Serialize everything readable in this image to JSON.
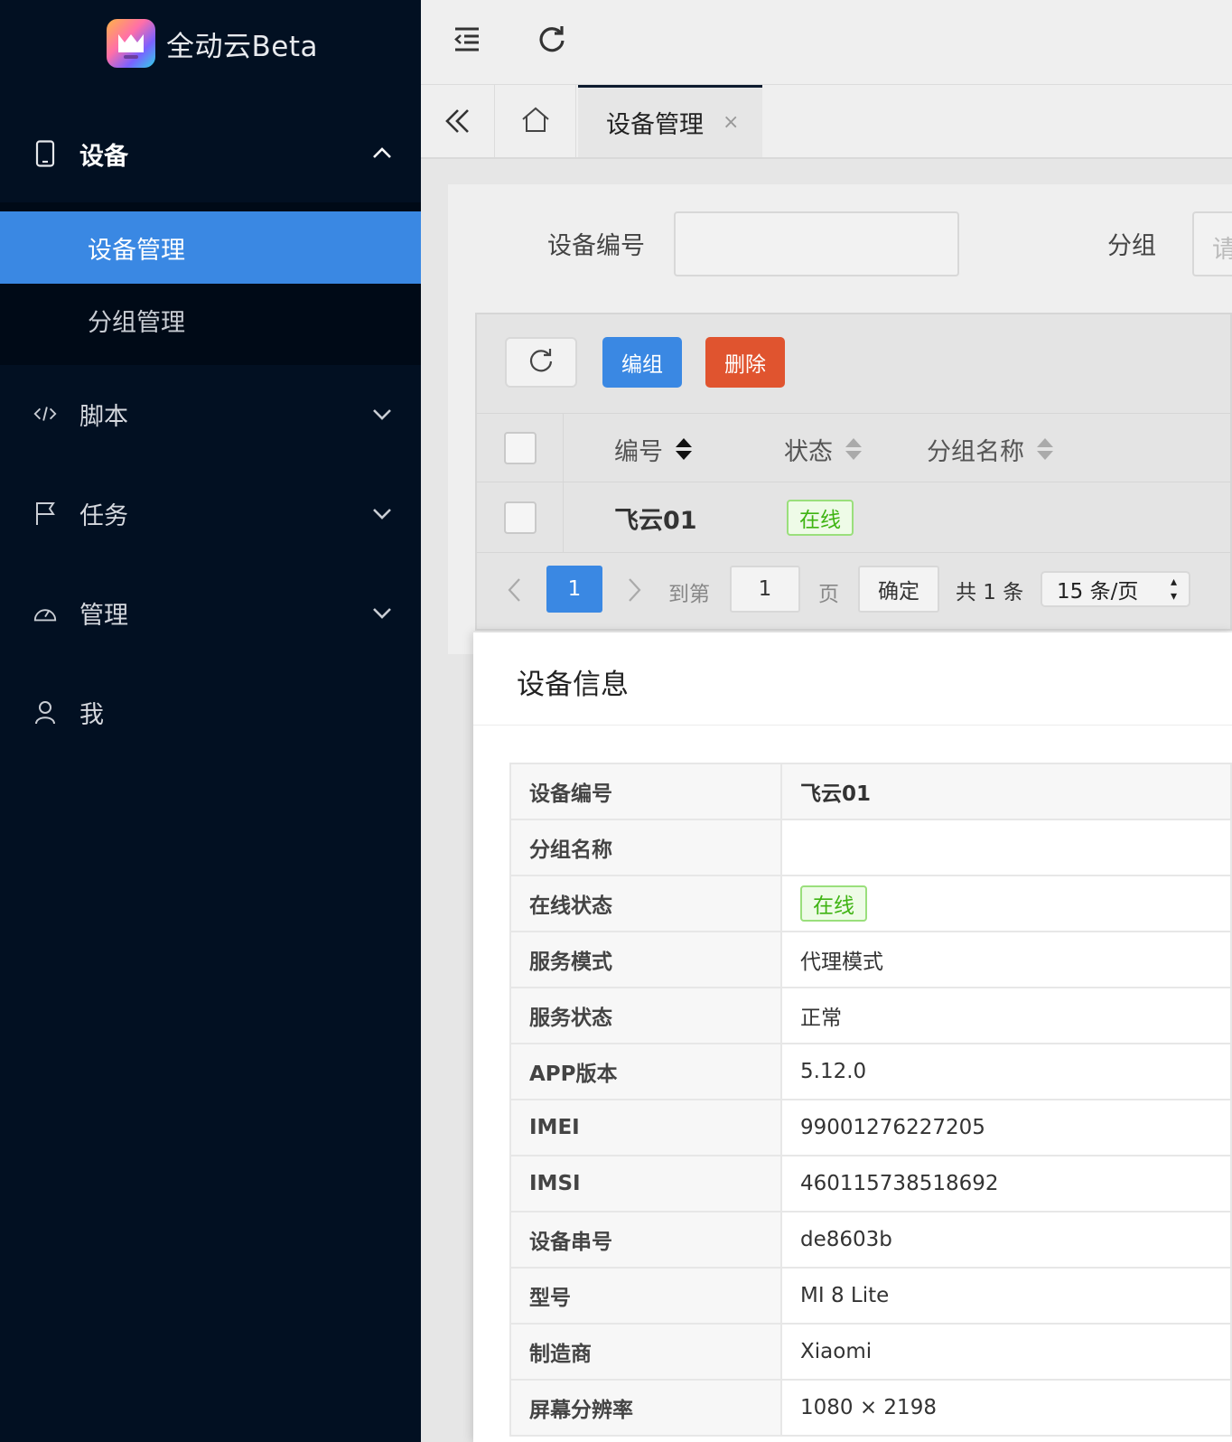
{
  "app": {
    "title": "全动云Beta"
  },
  "sidebar": {
    "device": {
      "label": "设备",
      "sub": [
        {
          "label": "设备管理"
        },
        {
          "label": "分组管理"
        }
      ]
    },
    "script": {
      "label": "脚本"
    },
    "task": {
      "label": "任务"
    },
    "manage": {
      "label": "管理"
    },
    "me": {
      "label": "我"
    }
  },
  "tabs": {
    "active": {
      "label": "设备管理",
      "close": "×"
    }
  },
  "filter": {
    "device_no_label": "设备编号",
    "device_no_value": "",
    "group_label": "分组",
    "group_placeholder": "请选择"
  },
  "toolbar": {
    "group_label": "编组",
    "delete_label": "删除"
  },
  "table": {
    "headers": {
      "no": "编号",
      "status": "状态",
      "group": "分组名称"
    },
    "rows": [
      {
        "no": "飞云01",
        "status": "在线",
        "group": ""
      }
    ]
  },
  "pager": {
    "current": "1",
    "goto_label": "到第",
    "goto_value": "1",
    "page_label": "页",
    "confirm_label": "确定",
    "total": "共 1 条",
    "page_size": "15 条/页"
  },
  "dialog": {
    "title": "设备信息",
    "rows": [
      {
        "k": "设备编号",
        "v": "飞云01"
      },
      {
        "k": "分组名称",
        "v": ""
      },
      {
        "k": "在线状态",
        "v": "在线"
      },
      {
        "k": "服务模式",
        "v": "代理模式"
      },
      {
        "k": "服务状态",
        "v": "正常"
      },
      {
        "k": "APP版本",
        "v": "5.12.0"
      },
      {
        "k": "IMEI",
        "v": "99001276227205"
      },
      {
        "k": "IMSI",
        "v": "460115738518692"
      },
      {
        "k": "设备串号",
        "v": "de8603b"
      },
      {
        "k": "型号",
        "v": "MI 8 Lite"
      },
      {
        "k": "制造商",
        "v": "Xiaomi"
      },
      {
        "k": "屏幕分辨率",
        "v": "1080 × 2198"
      }
    ]
  },
  "colors": {
    "sidebar_bg": "#021022",
    "active_blue": "#3a88e3",
    "danger": "#e0542f",
    "online_green": "#3fb413"
  },
  "icons": [
    "tablet-icon",
    "code-icon",
    "flag-icon",
    "dashboard-icon",
    "user-icon",
    "menu-fold-icon",
    "reload-icon",
    "double-left-icon",
    "home-icon",
    "close-icon",
    "refresh-icon",
    "chevron-up-icon",
    "chevron-down-icon",
    "sort-icon"
  ]
}
